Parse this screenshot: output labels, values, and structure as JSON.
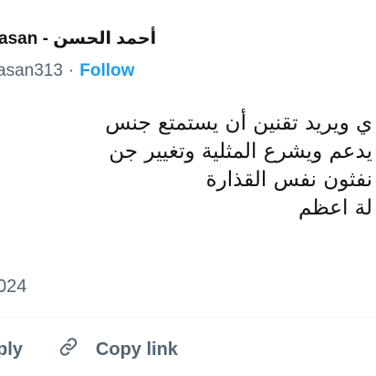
{
  "tweet": {
    "author": {
      "display_name": "أحمد الحسن - ...asan",
      "handle": "...asan313"
    },
    "follow_label": "Follow",
    "separator": "·",
    "body_lines": [
      "...ي ويريد تقنين أن يستمتع جنس",
      "...يدعم ويشرع المثلية وتغيير جن",
      "...نفثون نفس القذارة",
      "...لة اعظم"
    ],
    "date": "...024"
  },
  "actions": {
    "reply_label": "...ply",
    "copy_link_label": "Copy link",
    "copy_link_icon": "link-icon"
  },
  "colors": {
    "accent": "#1d9bf0",
    "text": "#0f1419",
    "secondary_text": "#536471",
    "divider": "#eff3f4"
  }
}
